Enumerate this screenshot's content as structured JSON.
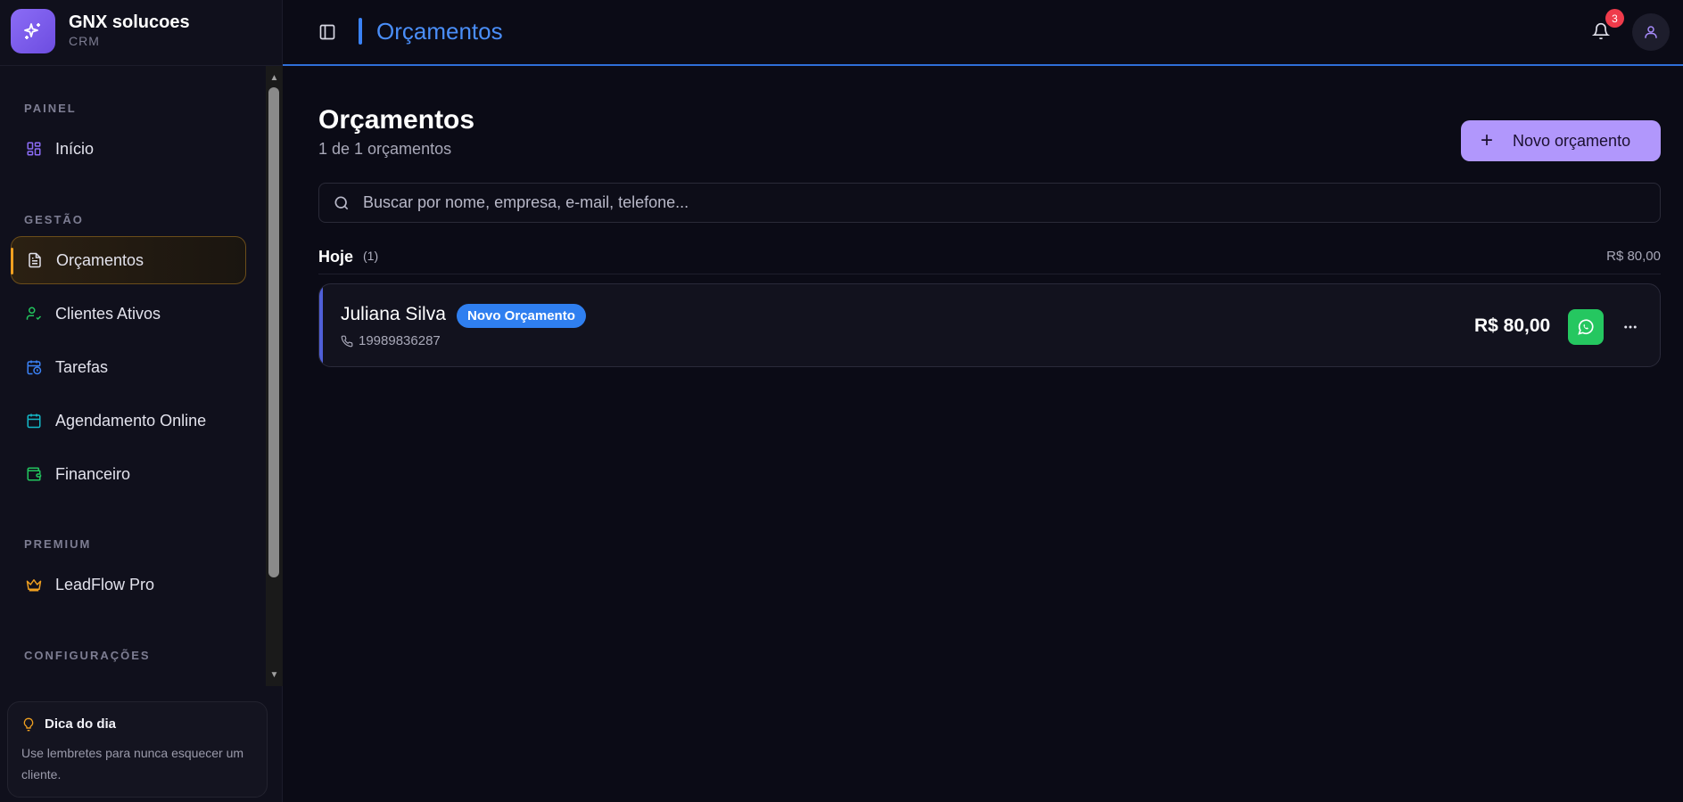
{
  "brand": {
    "name": "GNX solucoes",
    "sub": "CRM",
    "logo_icon": "sparkles-icon"
  },
  "sidebar": {
    "sections": [
      {
        "label": "PAINEL"
      },
      {
        "label": "GESTÃO"
      },
      {
        "label": "PREMIUM"
      },
      {
        "label": "CONFIGURAÇÕES"
      }
    ],
    "items": [
      {
        "label": "Início",
        "icon": "dashboard-icon",
        "color": "#8b6cf6"
      },
      {
        "label": "Orçamentos",
        "icon": "document-icon",
        "active": true,
        "color": "#e2e2ec"
      },
      {
        "label": "Clientes Ativos",
        "icon": "user-check-icon",
        "color": "#22c55e"
      },
      {
        "label": "Tarefas",
        "icon": "calendar-clock-icon",
        "color": "#3b82f6"
      },
      {
        "label": "Agendamento Online",
        "icon": "calendar-icon",
        "color": "#14b8c8"
      },
      {
        "label": "Financeiro",
        "icon": "wallet-icon",
        "color": "#22c55e"
      },
      {
        "label": "LeadFlow Pro",
        "icon": "crown-icon",
        "color": "#f0a020"
      }
    ]
  },
  "tip": {
    "title": "Dica do dia",
    "text": "Use lembretes para nunca esquecer um cliente."
  },
  "header": {
    "title": "Orçamentos",
    "notification_count": "3"
  },
  "main": {
    "title": "Orçamentos",
    "subtitle": "1 de 1 orçamentos",
    "new_button_label": "Novo orçamento",
    "search_placeholder": "Buscar por nome, empresa, e-mail, telefone...",
    "groups": [
      {
        "name": "Hoje",
        "count": "(1)",
        "total": "R$ 80,00",
        "items": [
          {
            "client": "Juliana Silva",
            "status": "Novo Orçamento",
            "phone": "19989836287",
            "amount": "R$ 80,00"
          }
        ]
      }
    ]
  },
  "colors": {
    "accent_purple": "#b197fc",
    "accent_blue": "#3a82f6",
    "active_orange": "#f0a020",
    "whatsapp_green": "#25c760",
    "badge_red": "#ef3b4b"
  }
}
